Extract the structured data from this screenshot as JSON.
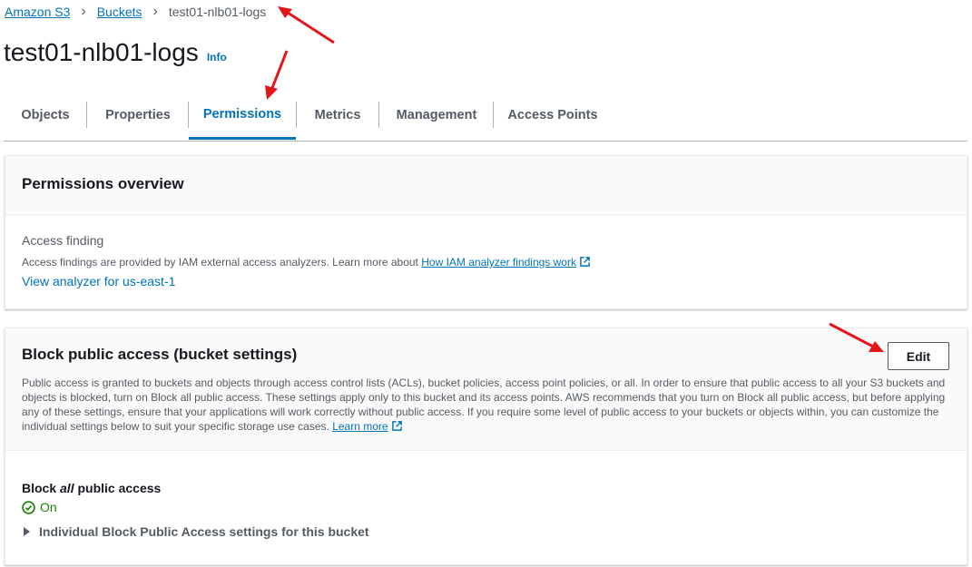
{
  "breadcrumb": {
    "root": "Amazon S3",
    "parent": "Buckets",
    "current": "test01-nlb01-logs"
  },
  "page": {
    "title": "test01-nlb01-logs",
    "info": "Info"
  },
  "tabs": [
    {
      "label": "Objects"
    },
    {
      "label": "Properties"
    },
    {
      "label": "Permissions",
      "active": true
    },
    {
      "label": "Metrics"
    },
    {
      "label": "Management"
    },
    {
      "label": "Access Points"
    }
  ],
  "overview": {
    "title": "Permissions overview",
    "access_label": "Access finding",
    "access_desc": "Access findings are provided by IAM external access analyzers. Learn more about",
    "access_link": "How IAM analyzer findings work",
    "analyzer_link": "View analyzer for us-east-1"
  },
  "block": {
    "title": "Block public access (bucket settings)",
    "edit_label": "Edit",
    "description": "Public access is granted to buckets and objects through access control lists (ACLs), bucket policies, access point policies, or all. In order to ensure that public access to all your S3 buckets and objects is blocked, turn on Block all public access. These settings apply only to this bucket and its access points. AWS recommends that you turn on Block all public access, but before applying any of these settings, ensure that your applications will work correctly without public access. If you require some level of public access to your buckets or objects within, you can customize the individual settings below to suit your specific storage use cases.",
    "learn_more": "Learn more",
    "setting_prefix": "Block",
    "setting_emph": "all",
    "setting_suffix": "public access",
    "status": "On",
    "individual_label": "Individual Block Public Access settings for this bucket"
  },
  "colors": {
    "link": "#0073bb",
    "status_green": "#1d8102",
    "annotation_red": "#e3161b"
  }
}
